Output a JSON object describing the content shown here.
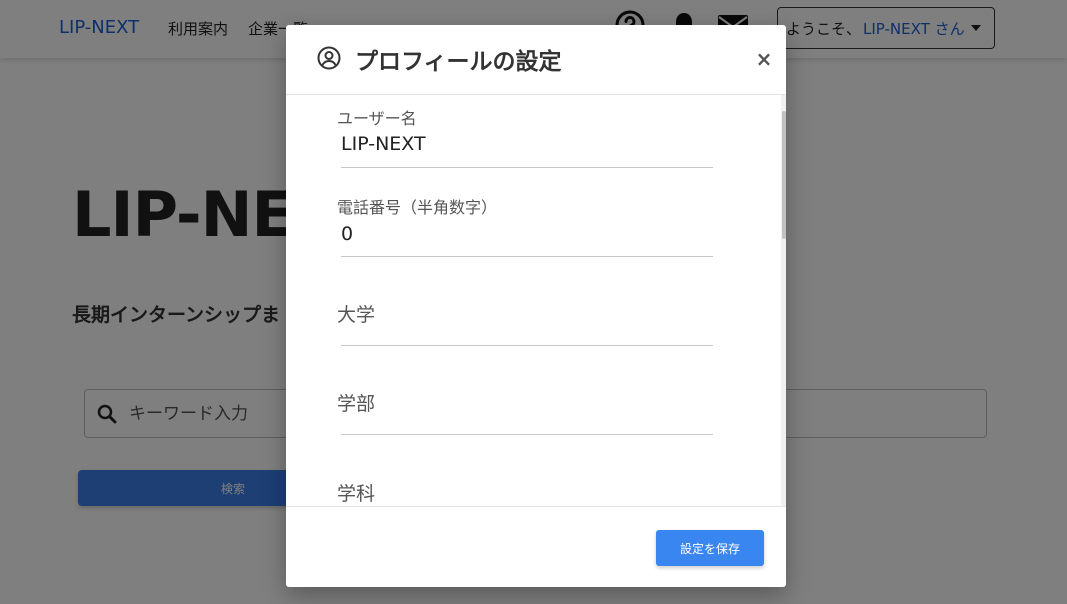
{
  "navbar": {
    "brand": "LIP-NEXT",
    "links": [
      "利用案内",
      "企業一覧"
    ],
    "icons": [
      "help-icon",
      "bell-icon",
      "mail-icon"
    ],
    "welcome": {
      "prefix": "ようこそ、",
      "user": "LIP-NEXT さん"
    }
  },
  "hero": {
    "title": "LIP-NEXT",
    "subtitle": "長期インターンシップま"
  },
  "search": {
    "placeholder": "キーワード入力",
    "button_label": "検索"
  },
  "modal": {
    "title": "プロフィールの設定",
    "close_label": "×",
    "fields": [
      {
        "label": "ユーザー名",
        "value": "LIP-NEXT"
      },
      {
        "label": "電話番号（半角数字）",
        "value": "0"
      },
      {
        "label": "大学",
        "value": ""
      },
      {
        "label": "学部",
        "value": ""
      },
      {
        "label": "学科",
        "value": ""
      }
    ],
    "save_label": "設定を保存"
  },
  "colors": {
    "brand": "#1d5fd1",
    "primary_button": "#3a86f0",
    "overlay": "rgba(0,0,0,0.5)"
  }
}
